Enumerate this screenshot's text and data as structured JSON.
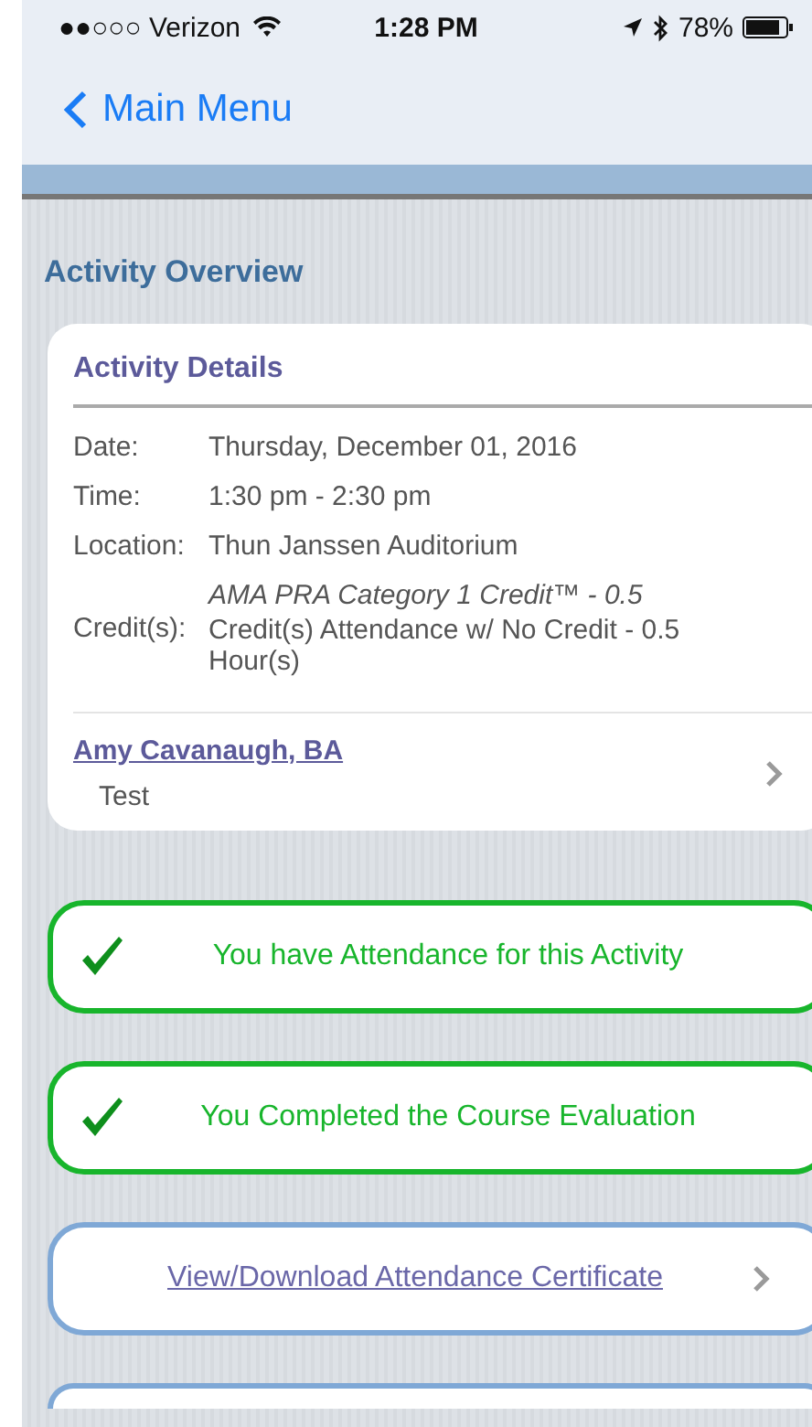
{
  "status_bar": {
    "carrier": "●●○○○ Verizon",
    "time": "1:28 PM",
    "battery": "78%"
  },
  "nav": {
    "back_label": "Main Menu"
  },
  "section_title": "Activity Overview",
  "details_card": {
    "title": "Activity Details",
    "rows": [
      {
        "label": "Date:",
        "lines": [
          {
            "text": "Thursday, December 01, 2016",
            "italic": false
          }
        ]
      },
      {
        "label": "Time:",
        "lines": [
          {
            "text": "1:30 pm - 2:30 pm",
            "italic": false
          }
        ]
      },
      {
        "label": "Location:",
        "lines": [
          {
            "text": "Thun Janssen Auditorium",
            "italic": false
          }
        ]
      },
      {
        "label": "Credit(s):",
        "lines": [
          {
            "text": "AMA PRA Category 1 Credit™ - 0.5",
            "italic": true
          },
          {
            "text": "Credit(s) Attendance w/ No Credit - 0.5 Hour(s)",
            "italic": false
          }
        ]
      }
    ],
    "presenter": {
      "name": "Amy Cavanaugh, BA",
      "role": "Test"
    }
  },
  "actions": [
    {
      "kind": "status",
      "text": "You have Attendance for this Activity"
    },
    {
      "kind": "status",
      "text": "You Completed the Course Evaluation"
    },
    {
      "kind": "link",
      "text": "View/Download Attendance Certificate"
    },
    {
      "kind": "empty"
    }
  ]
}
